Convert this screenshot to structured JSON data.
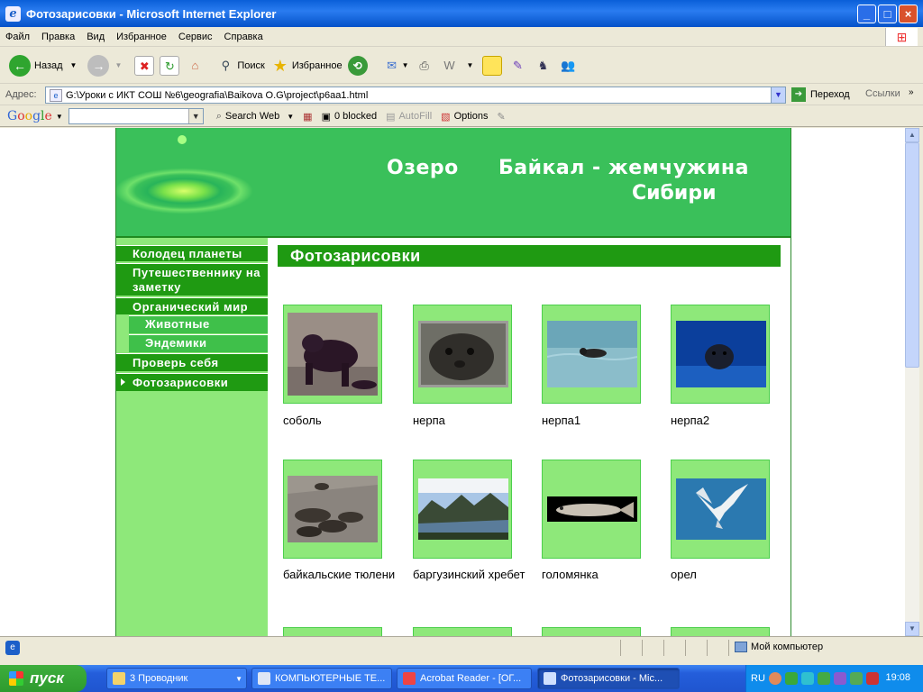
{
  "window": {
    "title": "Фотозарисовки - Microsoft Internet Explorer"
  },
  "menu": [
    "Файл",
    "Правка",
    "Вид",
    "Избранное",
    "Сервис",
    "Справка"
  ],
  "toolbar": {
    "back": "Назад",
    "search": "Поиск",
    "favorites": "Избранное"
  },
  "address": {
    "label": "Адрес:",
    "url": "G:\\Уроки с ИКТ СОШ №6\\geografia\\Baikova O.G\\project\\p6aa1.html",
    "go": "Переход",
    "links": "Ссылки"
  },
  "googlebar": {
    "logo": "Google",
    "search_web": "Search Web",
    "blocked": "0 blocked",
    "autofill": "AutoFill",
    "options": "Options"
  },
  "page": {
    "header_title_line1a": "Озеро",
    "header_title_line1b": "Байкал -  жемчужина",
    "header_title_line2": "Сибири",
    "nav": [
      {
        "label": "Колодец планеты"
      },
      {
        "label": "Путешественнику на заметку"
      },
      {
        "label": "Органический мир"
      },
      {
        "label": "Животные"
      },
      {
        "label": "Эндемики"
      },
      {
        "label": "Проверь себя"
      },
      {
        "label": "Фотозарисовки"
      }
    ],
    "section_title": "Фотозарисовки",
    "photos": [
      {
        "caption": "соболь"
      },
      {
        "caption": "нерпа"
      },
      {
        "caption": "нерпа1"
      },
      {
        "caption": "нерпа2"
      },
      {
        "caption": "байкальские тюлени"
      },
      {
        "caption": "баргузинский хребет"
      },
      {
        "caption": "голомянка"
      },
      {
        "caption": "орел"
      }
    ]
  },
  "statusbar": {
    "zone": "Мой компьютер"
  },
  "taskbar": {
    "start": "пуск",
    "tasks": [
      "3 Проводник",
      "КОМПЬЮТЕРНЫЕ ТЕ...",
      "Acrobat Reader - [ОГ...",
      "Фотозарисовки - Mic..."
    ],
    "lang": "RU",
    "clock": "19:08"
  }
}
